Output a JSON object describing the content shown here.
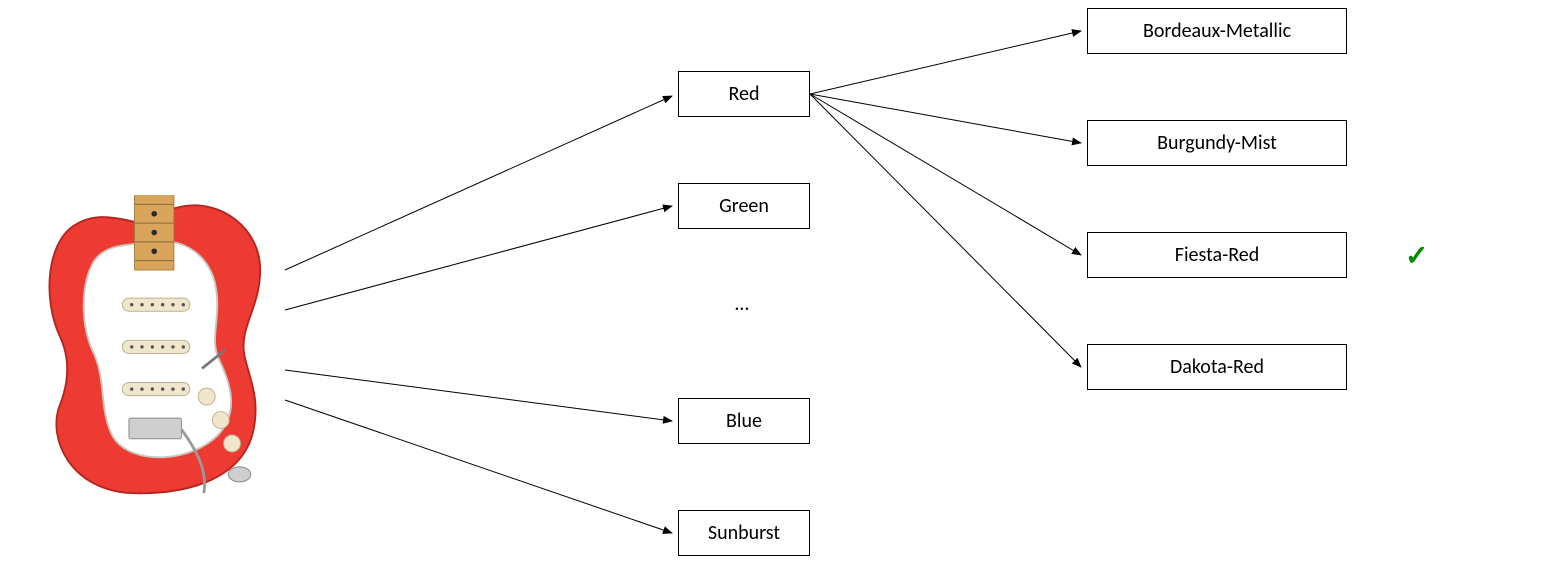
{
  "image": {
    "label": "guitar-image",
    "body_color": "#ED3A33",
    "pickguard_color": "#FFFFFF",
    "neck_color": "#E6B87A",
    "fretboard_color": "#D9A45B"
  },
  "level1": {
    "items": [
      {
        "id": "red",
        "label": "Red"
      },
      {
        "id": "green",
        "label": "Green"
      },
      {
        "id": "ellipsis",
        "label": "…"
      },
      {
        "id": "blue",
        "label": "Blue"
      },
      {
        "id": "sunburst",
        "label": "Sunburst"
      }
    ]
  },
  "level2": {
    "parent": "red",
    "items": [
      {
        "id": "bordeaux",
        "label": "Bordeaux-Metallic",
        "selected": false
      },
      {
        "id": "burgundy",
        "label": "Burgundy-Mist",
        "selected": false
      },
      {
        "id": "fiesta",
        "label": "Fiesta-Red",
        "selected": true
      },
      {
        "id": "dakota",
        "label": "Dakota-Red",
        "selected": false
      }
    ]
  },
  "checkmark": "✓"
}
